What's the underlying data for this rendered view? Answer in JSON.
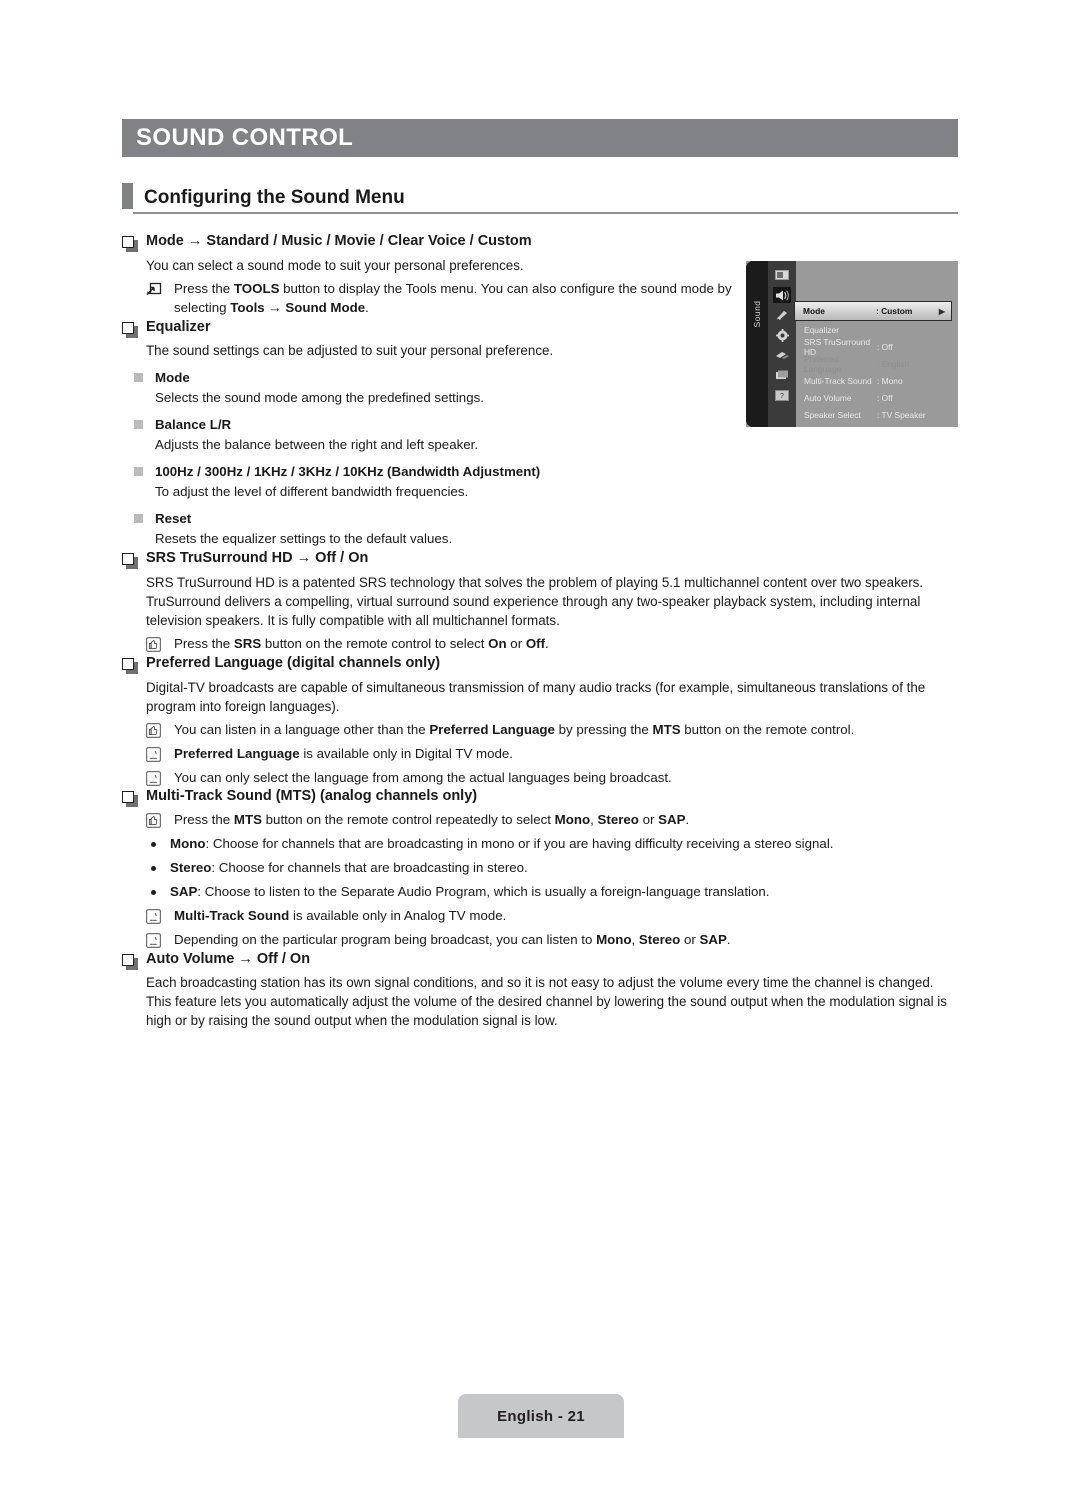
{
  "chapter": {
    "title": "SOUND CONTROL"
  },
  "section": {
    "title": "Configuring the Sound Menu"
  },
  "mode": {
    "heading": "Mode → Standard / Music / Movie / Clear Voice / Custom",
    "desc": "You can select a sound mode to suit your personal preferences.",
    "tools_note_1": "Press the ",
    "tools_note_bold_1": "TOOLS",
    "tools_note_2": " button to display the Tools menu. You can also configure the sound mode by selecting ",
    "tools_note_bold_2": "Tools",
    "tools_note_3": " → ",
    "tools_note_bold_3": "Sound Mode",
    "tools_note_4": "."
  },
  "equalizer": {
    "heading": "Equalizer",
    "desc": "The sound settings can be adjusted to suit your personal preference.",
    "items": [
      {
        "label": "Mode",
        "desc": "Selects the sound mode among the predefined settings."
      },
      {
        "label": "Balance L/R",
        "desc": "Adjusts the balance between the right and left speaker."
      },
      {
        "label": "100Hz / 300Hz / 1KHz / 3KHz / 10KHz (Bandwidth Adjustment)",
        "desc": "To adjust the level of different bandwidth frequencies."
      },
      {
        "label": "Reset",
        "desc": "Resets the equalizer settings to the default values."
      }
    ]
  },
  "srs": {
    "heading": "SRS TruSurround HD → Off / On",
    "desc": "SRS TruSurround HD is a patented SRS technology that solves the problem of playing 5.1 multichannel content over two speakers. TruSurround delivers a compelling, virtual surround sound experience through any two-speaker playback system, including internal television speakers. It is fully compatible with all multichannel formats.",
    "note_1": "Press the ",
    "note_bold_1": "SRS",
    "note_2": " button on the remote control to select ",
    "note_bold_2": "On",
    "note_3": " or ",
    "note_bold_3": "Off",
    "note_4": "."
  },
  "preferred_language": {
    "heading": "Preferred Language (digital channels only)",
    "desc": "Digital-TV broadcasts are capable of simultaneous transmission of many audio tracks (for example, simultaneous translations of the program into foreign languages).",
    "note1_1": "You can listen in a language other than the ",
    "note1_bold_1": "Preferred Language",
    "note1_2": " by pressing the ",
    "note1_bold_2": "MTS",
    "note1_3": " button on the remote control.",
    "note2_bold_1": "Preferred Language",
    "note2_1": " is available only in Digital TV mode.",
    "note3_1": "You can only select the language from among the actual languages being broadcast."
  },
  "mts": {
    "heading": "Multi-Track Sound (MTS) (analog channels only)",
    "note1_1": "Press the ",
    "note1_bold_1": "MTS",
    "note1_2": " button on the remote control repeatedly to select ",
    "note1_bold_2": "Mono",
    "note1_3": ", ",
    "note1_bold_3": "Stereo",
    "note1_4": " or ",
    "note1_bold_4": "SAP",
    "note1_5": ".",
    "bullets": [
      {
        "term": "Mono",
        "desc": ": Choose for channels that are broadcasting in mono or if you are having difficulty receiving a stereo signal."
      },
      {
        "term": "Stereo",
        "desc": ": Choose for channels that are broadcasting in stereo."
      },
      {
        "term": "SAP",
        "desc": ": Choose to listen to the Separate Audio Program, which is usually a foreign-language translation."
      }
    ],
    "note2_bold_1": "Multi-Track Sound",
    "note2_1": " is available only in Analog TV mode.",
    "note3_1": "Depending on the particular program being broadcast, you can listen to ",
    "note3_bold_1": "Mono",
    "note3_2": ", ",
    "note3_bold_2": "Stereo",
    "note3_3": " or ",
    "note3_bold_3": "SAP",
    "note3_4": "."
  },
  "auto_volume": {
    "heading": "Auto Volume → Off / On",
    "desc": "Each broadcasting station has its own signal conditions, and so it is not easy to adjust the volume every time the channel is changed. This feature lets you automatically adjust the volume of the desired channel by lowering the sound output when the modulation signal is high or by raising the sound output when the modulation signal is low."
  },
  "osd": {
    "rail_label": "Sound",
    "sidebar_icons": [
      "picture-icon",
      "sound-icon",
      "channel-icon",
      "setup-icon",
      "input-icon",
      "application-icon",
      "support-icon"
    ],
    "rows": [
      {
        "label": "Mode",
        "value": ": Custom",
        "state": "highlighted",
        "arrow": "▶"
      },
      {
        "label": "Equalizer",
        "value": "",
        "state": "normal"
      },
      {
        "label": "SRS TruSurround HD",
        "value": ": Off",
        "state": "normal"
      },
      {
        "label": "Preferred Language",
        "value": ": English",
        "state": "dimmed"
      },
      {
        "label": "Multi-Track Sound",
        "value": ": Mono",
        "state": "normal"
      },
      {
        "label": "Auto Volume",
        "value": ": Off",
        "state": "normal"
      },
      {
        "label": "Speaker Select",
        "value": ": TV Speaker",
        "state": "normal"
      }
    ]
  },
  "footer": {
    "page_label": "English - 21"
  },
  "colors": {
    "banner": "#808285",
    "accent_rule": "#8d9196",
    "page_tag": "#c6c7c9",
    "text": "#231f20"
  }
}
